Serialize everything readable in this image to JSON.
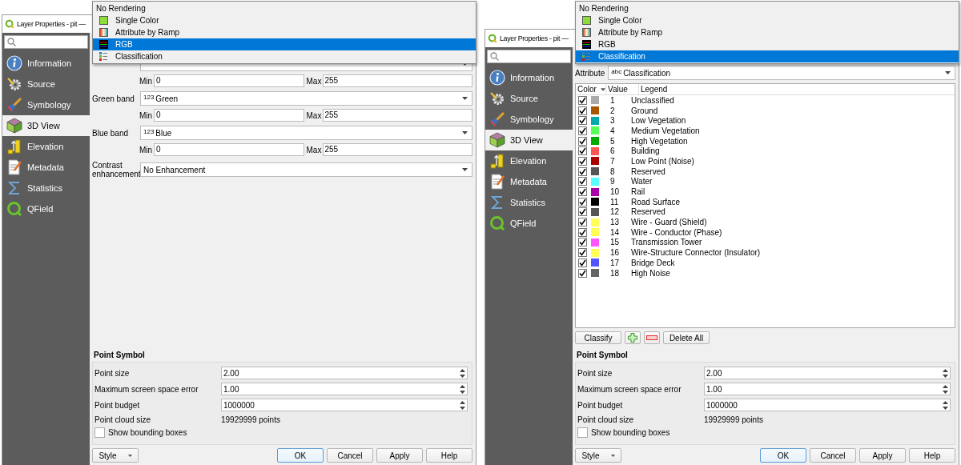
{
  "dialogs": [
    {
      "title": "Layer Properties - pit —",
      "renderer_menu": [
        {
          "label": "No Rendering",
          "kind": "none",
          "selected": false
        },
        {
          "label": "Single Color",
          "kind": "single",
          "selected": false
        },
        {
          "label": "Attribute by Ramp",
          "kind": "ramp",
          "selected": false
        },
        {
          "label": "RGB",
          "kind": "rgb",
          "selected": true
        },
        {
          "label": "Classification",
          "kind": "classified",
          "selected": false
        }
      ],
      "sidebar": [
        {
          "label": "Information",
          "selected": false
        },
        {
          "label": "Source",
          "selected": false
        },
        {
          "label": "Symbology",
          "selected": false
        },
        {
          "label": "3D View",
          "selected": true
        },
        {
          "label": "Elevation",
          "selected": false
        },
        {
          "label": "Metadata",
          "selected": false
        },
        {
          "label": "Statistics",
          "selected": false
        },
        {
          "label": "QField",
          "selected": false
        }
      ],
      "content": {
        "kind": "rgb",
        "bands": [
          {
            "min_label": "Min",
            "min": "0",
            "max_label": "Max",
            "max": "255"
          },
          {
            "label": "Green band",
            "badge": "123",
            "value": "Green",
            "min_label": "Min",
            "min": "0",
            "max_label": "Max",
            "max": "255"
          },
          {
            "label": "Blue band",
            "badge": "123",
            "value": "Blue",
            "min_label": "Min",
            "min": "0",
            "max_label": "Max",
            "max": "255"
          }
        ],
        "contrast": {
          "label": "Contrast enhancement",
          "value": "No Enhancement"
        }
      },
      "point_symbol": {
        "title": "Point Symbol",
        "fields": [
          {
            "label": "Point size",
            "value": "2.00"
          },
          {
            "label": "Maximum screen space error",
            "value": "1.00"
          },
          {
            "label": "Point budget",
            "value": "1000000"
          }
        ],
        "info": {
          "label": "Point cloud size",
          "value": "19929999 points"
        },
        "checkbox": {
          "label": "Show bounding boxes",
          "checked": false
        }
      },
      "footer": {
        "style": "Style",
        "buttons": [
          {
            "label": "OK",
            "default": true
          },
          {
            "label": "Cancel",
            "default": false
          },
          {
            "label": "Apply",
            "default": false
          },
          {
            "label": "Help",
            "default": false
          }
        ]
      }
    },
    {
      "title": "Layer Properties - pit —",
      "renderer_menu": [
        {
          "label": "No Rendering",
          "kind": "none",
          "selected": false
        },
        {
          "label": "Single Color",
          "kind": "single",
          "selected": false
        },
        {
          "label": "Attribute by Ramp",
          "kind": "ramp",
          "selected": false
        },
        {
          "label": "RGB",
          "kind": "rgb",
          "selected": false
        },
        {
          "label": "Classification",
          "kind": "classified",
          "selected": true
        }
      ],
      "sidebar": [
        {
          "label": "Information",
          "selected": false
        },
        {
          "label": "Source",
          "selected": false
        },
        {
          "label": "Symbology",
          "selected": false
        },
        {
          "label": "3D View",
          "selected": true
        },
        {
          "label": "Elevation",
          "selected": false
        },
        {
          "label": "Metadata",
          "selected": false
        },
        {
          "label": "Statistics",
          "selected": false
        },
        {
          "label": "QField",
          "selected": false
        }
      ],
      "content": {
        "kind": "classification",
        "attribute": {
          "label": "Attribute",
          "badge": "abc",
          "value": "Classification"
        },
        "columns": [
          {
            "label": "Color",
            "sorted": true
          },
          {
            "label": "Value",
            "sorted": false
          },
          {
            "label": "Legend",
            "sorted": false
          }
        ],
        "rows": [
          {
            "checked": true,
            "color": "#aaaaaa",
            "value": "1",
            "legend": "Unclassified"
          },
          {
            "checked": true,
            "color": "#aa5500",
            "value": "2",
            "legend": "Ground"
          },
          {
            "checked": true,
            "color": "#00aaaa",
            "value": "3",
            "legend": "Low Vegetation"
          },
          {
            "checked": true,
            "color": "#55ff55",
            "value": "4",
            "legend": "Medium Vegetation"
          },
          {
            "checked": true,
            "color": "#00aa00",
            "value": "5",
            "legend": "High Vegetation"
          },
          {
            "checked": true,
            "color": "#ff5555",
            "value": "6",
            "legend": "Building"
          },
          {
            "checked": true,
            "color": "#aa0000",
            "value": "7",
            "legend": "Low Point (Noise)"
          },
          {
            "checked": true,
            "color": "#555555",
            "value": "8",
            "legend": "Reserved"
          },
          {
            "checked": true,
            "color": "#55ffff",
            "value": "9",
            "legend": "Water"
          },
          {
            "checked": true,
            "color": "#aa00aa",
            "value": "10",
            "legend": "Rail"
          },
          {
            "checked": true,
            "color": "#000000",
            "value": "11",
            "legend": "Road Surface"
          },
          {
            "checked": true,
            "color": "#555555",
            "value": "12",
            "legend": "Reserved"
          },
          {
            "checked": true,
            "color": "#ffff55",
            "value": "13",
            "legend": "Wire - Guard (Shield)"
          },
          {
            "checked": true,
            "color": "#ffff55",
            "value": "14",
            "legend": "Wire - Conductor (Phase)"
          },
          {
            "checked": true,
            "color": "#ff55ff",
            "value": "15",
            "legend": "Transmission Tower"
          },
          {
            "checked": true,
            "color": "#ffff55",
            "value": "16",
            "legend": "Wire-Structure Connector (Insulator)"
          },
          {
            "checked": true,
            "color": "#5555ff",
            "value": "17",
            "legend": "Bridge Deck"
          },
          {
            "checked": true,
            "color": "#646464",
            "value": "18",
            "legend": "High Noise"
          }
        ],
        "buttons": [
          {
            "kind": "text",
            "label": "Classify"
          },
          {
            "kind": "add"
          },
          {
            "kind": "remove"
          },
          {
            "kind": "text",
            "label": "Delete All"
          }
        ]
      },
      "point_symbol": {
        "title": "Point Symbol",
        "fields": [
          {
            "label": "Point size",
            "value": "2.00"
          },
          {
            "label": "Maximum screen space error",
            "value": "1.00"
          },
          {
            "label": "Point budget",
            "value": "1000000"
          }
        ],
        "info": {
          "label": "Point cloud size",
          "value": "19929999 points"
        },
        "checkbox": {
          "label": "Show bounding boxes",
          "checked": false
        }
      },
      "footer": {
        "style": "Style",
        "buttons": [
          {
            "label": "OK",
            "default": true
          },
          {
            "label": "Cancel",
            "default": false
          },
          {
            "label": "Apply",
            "default": false
          },
          {
            "label": "Help",
            "default": false
          }
        ]
      }
    }
  ]
}
